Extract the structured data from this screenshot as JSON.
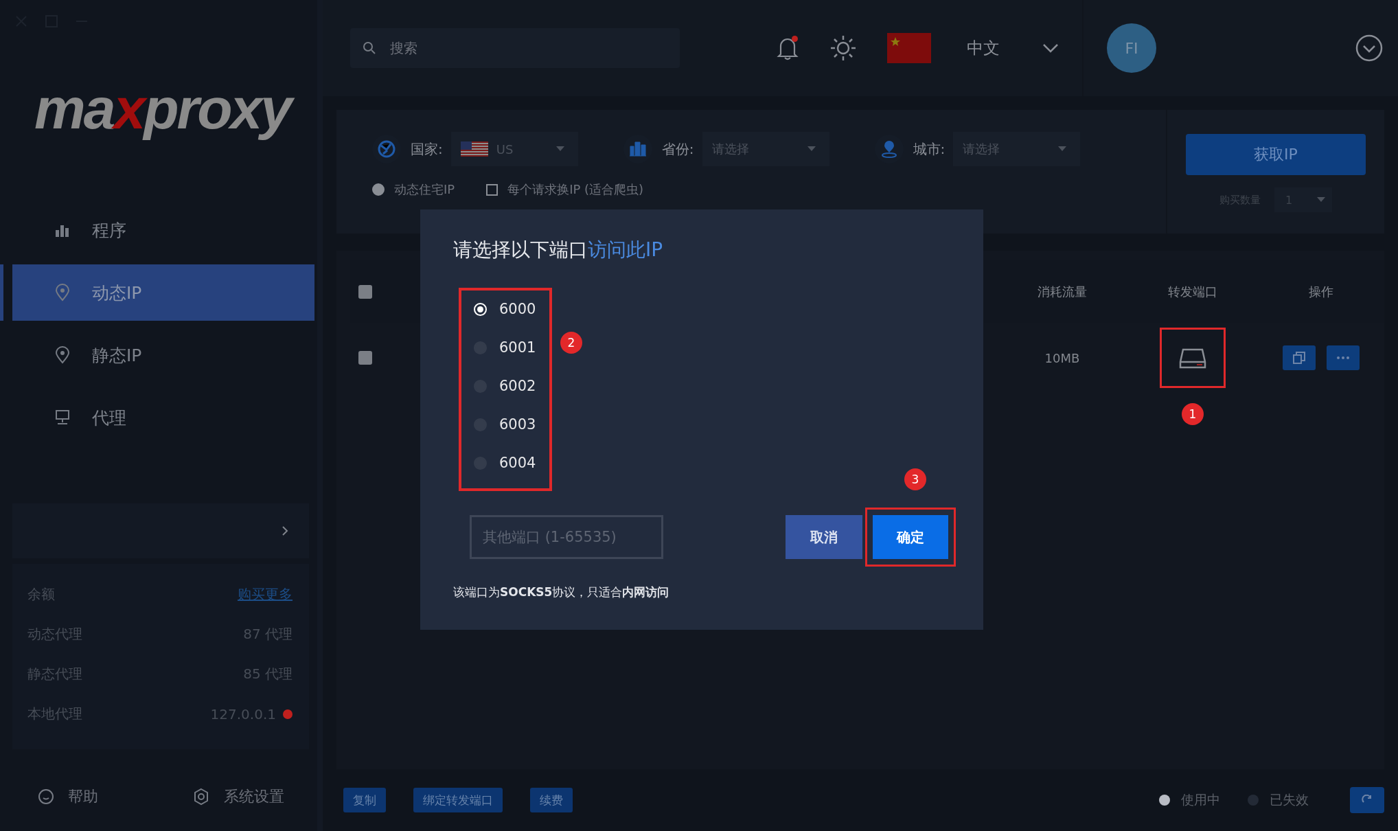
{
  "logo": {
    "before": "ma",
    "accent": "x",
    "after": "proxy"
  },
  "nav": [
    {
      "label": "程序",
      "selected": false
    },
    {
      "label": "动态IP",
      "selected": true
    },
    {
      "label": "静态IP",
      "selected": false
    },
    {
      "label": "代理",
      "selected": false
    }
  ],
  "stats": [
    {
      "label": "余额",
      "value": "购买更多",
      "kind": "link"
    },
    {
      "label": "动态代理",
      "value": "87 代理",
      "kind": "text"
    },
    {
      "label": "静态代理",
      "value": "85 代理",
      "kind": "text"
    },
    {
      "label": "本地代理",
      "value": "127.0.0.1",
      "kind": "status",
      "color": "#c0201e"
    }
  ],
  "footer_links": [
    "帮助",
    "系统设置"
  ],
  "topbar": {
    "search": {
      "placeholder": "搜索"
    },
    "unread": true,
    "language": "中文",
    "avatar": "FI"
  },
  "filters": {
    "country": {
      "label": "国家:",
      "value": "US"
    },
    "province": {
      "label": "省份:",
      "placeholder": "请选择"
    },
    "city": {
      "label": "城市:",
      "placeholder": "请选择"
    },
    "options": [
      {
        "kind": "radio",
        "label": "动态住宅IP",
        "checked": true
      },
      {
        "kind": "checkbox",
        "label": "每个请求换IP (适合爬虫)",
        "checked": false
      }
    ],
    "get_button": "获取IP",
    "quantity": {
      "label": "购买数量",
      "value": "1"
    }
  },
  "table": {
    "header_checked": false,
    "columns": [
      "消耗流量",
      "转发端口",
      "操作"
    ],
    "rows": [
      {
        "checked": false,
        "traffic": "10MB"
      }
    ]
  },
  "bottom_actions": [
    "复制",
    "绑定转发端口",
    "续费"
  ],
  "legend": [
    {
      "label": "使用中",
      "color": "#b8bcc4"
    },
    {
      "label": "已失效",
      "color": "#232a36"
    }
  ],
  "dialog": {
    "title": "请选择以下端口",
    "title_link": "访问此IP",
    "ports": [
      {
        "label": "6000",
        "selected": true
      },
      {
        "label": "6001",
        "selected": false
      },
      {
        "label": "6002",
        "selected": false
      },
      {
        "label": "6003",
        "selected": false
      },
      {
        "label": "6004",
        "selected": false
      }
    ],
    "custom_port": {
      "placeholder": "其他端口 (1-65535)"
    },
    "cancel": "取消",
    "confirm": "确定",
    "note": "该端口为**SOCKS5**协议，只适合**内网访问**"
  },
  "annotations": [
    "1",
    "2",
    "3"
  ]
}
